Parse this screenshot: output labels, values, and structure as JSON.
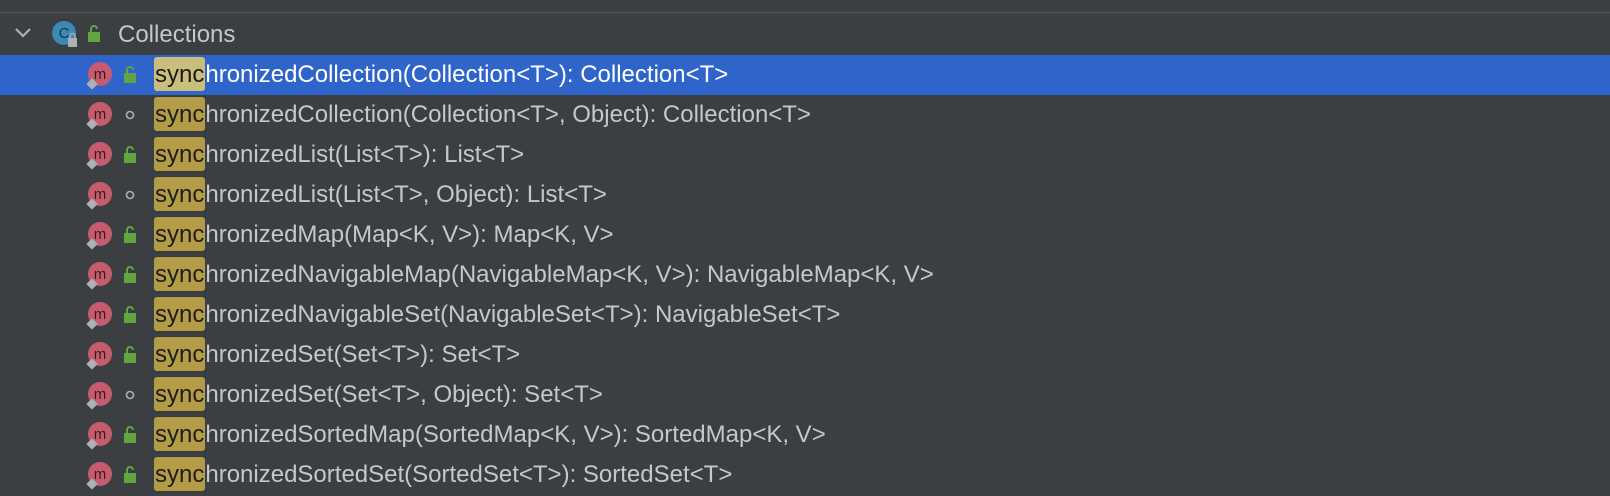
{
  "class_node": {
    "icon": "class-icon",
    "icon_letter": "C",
    "visibility_icon": "public-lock-icon",
    "label": "Collections",
    "expanded": true
  },
  "match_prefix": "sync",
  "methods": [
    {
      "rest": "hronizedCollection(Collection<T>): Collection<T>",
      "visibility": "public",
      "selected": true
    },
    {
      "rest": "hronizedCollection(Collection<T>, Object): Collection<T>",
      "visibility": "package",
      "selected": false
    },
    {
      "rest": "hronizedList(List<T>): List<T>",
      "visibility": "public",
      "selected": false
    },
    {
      "rest": "hronizedList(List<T>, Object): List<T>",
      "visibility": "package",
      "selected": false
    },
    {
      "rest": "hronizedMap(Map<K, V>): Map<K, V>",
      "visibility": "public",
      "selected": false
    },
    {
      "rest": "hronizedNavigableMap(NavigableMap<K, V>): NavigableMap<K, V>",
      "visibility": "public",
      "selected": false
    },
    {
      "rest": "hronizedNavigableSet(NavigableSet<T>): NavigableSet<T>",
      "visibility": "public",
      "selected": false
    },
    {
      "rest": "hronizedSet(Set<T>): Set<T>",
      "visibility": "public",
      "selected": false
    },
    {
      "rest": "hronizedSet(Set<T>, Object): Set<T>",
      "visibility": "package",
      "selected": false
    },
    {
      "rest": "hronizedSortedMap(SortedMap<K, V>): SortedMap<K, V>",
      "visibility": "public",
      "selected": false
    },
    {
      "rest": "hronizedSortedSet(SortedSet<T>): SortedSet<T>",
      "visibility": "public",
      "selected": false
    }
  ],
  "method_icon_letter": "m",
  "colors": {
    "background": "#3c3f41",
    "selection": "#2f65ca",
    "match_highlight": "#b39c45",
    "method_icon": "#c75b6e",
    "class_icon": "#3b8ab5",
    "public_lock": "#62a442"
  }
}
